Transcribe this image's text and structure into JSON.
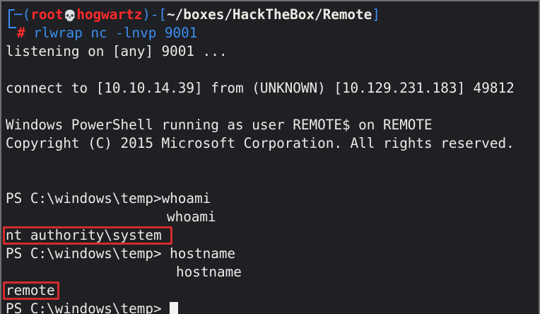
{
  "prompt": {
    "user": "root",
    "skull": "💀",
    "host": "hogwartz",
    "path": "~/boxes/HackTheBox/Remote",
    "symbol": "#",
    "command": "rlwrap nc -lnvp 9001"
  },
  "output": {
    "listening": "listening on [any] 9001 ...",
    "connect": "connect to [10.10.14.39] from (UNKNOWN) [10.129.231.183] 49812",
    "banner1": "Windows PowerShell running as user REMOTE$ on REMOTE",
    "banner2": "Copyright (C) 2015 Microsoft Corporation. All rights reserved.",
    "ps_prompt1": "PS C:\\windows\\temp>",
    "cmd1": "whoami",
    "echo1": "whoami",
    "result1": "nt authority\\system",
    "ps_prompt2": "PS C:\\windows\\temp>",
    "cmd2": " hostname",
    "echo2": "hostname",
    "result2": "remote",
    "ps_prompt3": "PS C:\\windows\\temp>"
  },
  "colors": {
    "background": "#1f2024",
    "text": "#ecece6",
    "prompt_blue": "#3a8ef2",
    "prompt_red": "#ff2b2b",
    "highlight_box": "#d42b2b"
  }
}
